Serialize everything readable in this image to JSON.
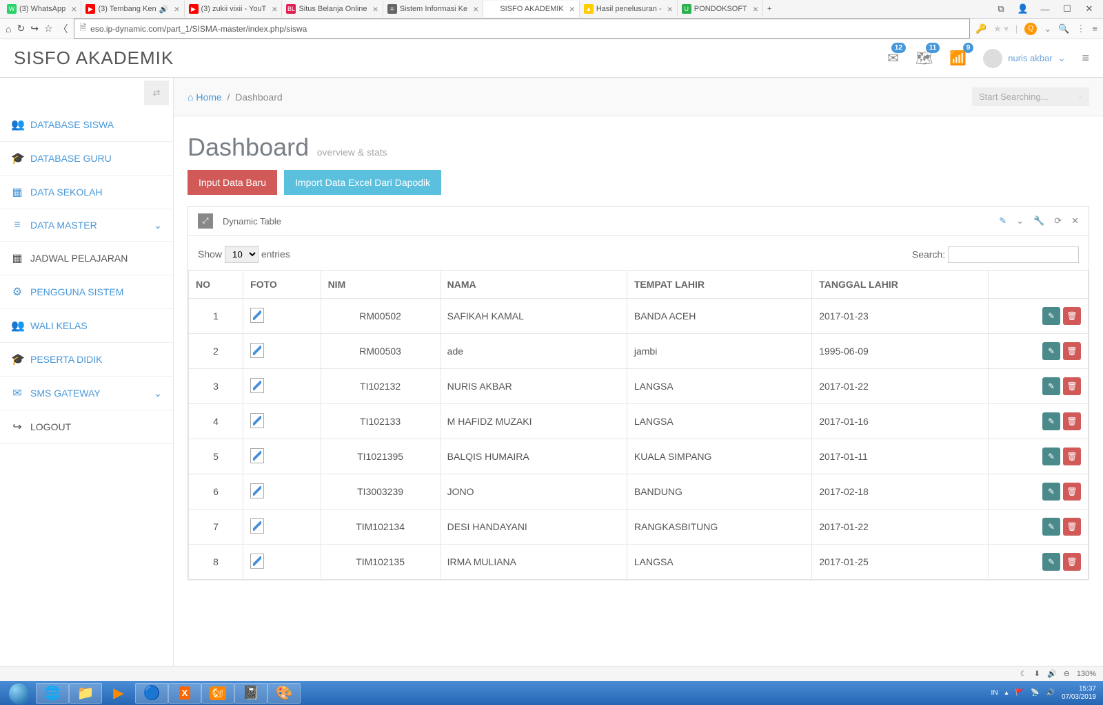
{
  "browser": {
    "tabs": [
      {
        "title": "(3) WhatsApp",
        "icon_bg": "#25d366",
        "icon_txt": "W"
      },
      {
        "title": "(3) Tembang Ken",
        "icon_bg": "#ff0000",
        "icon_txt": "▶",
        "speaker": true
      },
      {
        "title": "(3) zukii vixii - YouT",
        "icon_bg": "#ff0000",
        "icon_txt": "▶"
      },
      {
        "title": "Situs Belanja Online",
        "icon_bg": "#e31e52",
        "icon_txt": "BL"
      },
      {
        "title": "Sistem Informasi Ke",
        "icon_bg": "#666",
        "icon_txt": "≡"
      },
      {
        "title": "SISFO AKADEMIK",
        "icon_bg": "#fff",
        "icon_txt": ""
      },
      {
        "title": "Hasil penelusuran - ",
        "icon_bg": "#ffcc00",
        "icon_txt": "▲"
      },
      {
        "title": "PONDOKSOFT",
        "icon_bg": "#2bb24c",
        "icon_txt": "U"
      }
    ],
    "url": "eso.ip-dynamic.com/part_1/SISMA-master/index.php/siswa"
  },
  "header": {
    "brand": "SISFO AKADEMIK",
    "badges": {
      "mail": "12",
      "map": "11",
      "wifi": "9"
    },
    "user": "nuris akbar"
  },
  "sidebar": {
    "items": [
      {
        "label": "DATABASE SISWA",
        "icon": "👥",
        "blue": true
      },
      {
        "label": "DATABASE GURU",
        "icon": "🎓",
        "blue": true
      },
      {
        "label": "DATA SEKOLAH",
        "icon": "▦",
        "blue": true
      },
      {
        "label": "DATA MASTER",
        "icon": "≡",
        "blue": true,
        "chevron": true
      },
      {
        "label": "JADWAL PELAJARAN",
        "icon": "▦",
        "blue": false
      },
      {
        "label": "PENGGUNA SISTEM",
        "icon": "⚙",
        "blue": true
      },
      {
        "label": "WALI KELAS",
        "icon": "👥",
        "blue": true
      },
      {
        "label": "PESERTA DIDIK",
        "icon": "🎓",
        "blue": true
      },
      {
        "label": "SMS GATEWAY",
        "icon": "✉",
        "blue": true,
        "chevron": true
      },
      {
        "label": "LOGOUT",
        "icon": "↪",
        "blue": false
      }
    ]
  },
  "breadcrumb": {
    "home": "Home",
    "current": "Dashboard",
    "search_placeholder": "Start Searching..."
  },
  "page": {
    "title": "Dashboard",
    "subtitle": "overview & stats"
  },
  "buttons": {
    "input": "Input Data Baru",
    "import": "Import Data Excel Dari Dapodik"
  },
  "panel": {
    "title": "Dynamic Table"
  },
  "table": {
    "show_label": "Show",
    "entries_label": "entries",
    "entries_value": "10",
    "search_label": "Search:",
    "columns": [
      "NO",
      "FOTO",
      "NIM",
      "NAMA",
      "TEMPAT LAHIR",
      "TANGGAL LAHIR"
    ],
    "rows": [
      {
        "no": "1",
        "nim": "RM00502",
        "nama": "SAFIKAH KAMAL",
        "tempat": "BANDA ACEH",
        "tgl": "2017-01-23"
      },
      {
        "no": "2",
        "nim": "RM00503",
        "nama": "ade",
        "tempat": "jambi",
        "tgl": "1995-06-09"
      },
      {
        "no": "3",
        "nim": "TI102132",
        "nama": "NURIS AKBAR",
        "tempat": "LANGSA",
        "tgl": "2017-01-22"
      },
      {
        "no": "4",
        "nim": "TI102133",
        "nama": "M HAFIDZ MUZAKI",
        "tempat": "LANGSA",
        "tgl": "2017-01-16"
      },
      {
        "no": "5",
        "nim": "TI1021395",
        "nama": "BALQIS HUMAIRA",
        "tempat": "KUALA SIMPANG",
        "tgl": "2017-01-11"
      },
      {
        "no": "6",
        "nim": "TI3003239",
        "nama": "JONO",
        "tempat": "BANDUNG",
        "tgl": "2017-02-18"
      },
      {
        "no": "7",
        "nim": "TIM102134",
        "nama": "DESI HANDAYANI",
        "tempat": "RANGKASBITUNG",
        "tgl": "2017-01-22"
      },
      {
        "no": "8",
        "nim": "TIM102135",
        "nama": "IRMA MULIANA",
        "tempat": "LANGSA",
        "tgl": "2017-01-25"
      }
    ]
  },
  "taskbar": {
    "lang": "IN",
    "time": "15:37",
    "date": "07/03/2019",
    "zoom": "130%"
  }
}
